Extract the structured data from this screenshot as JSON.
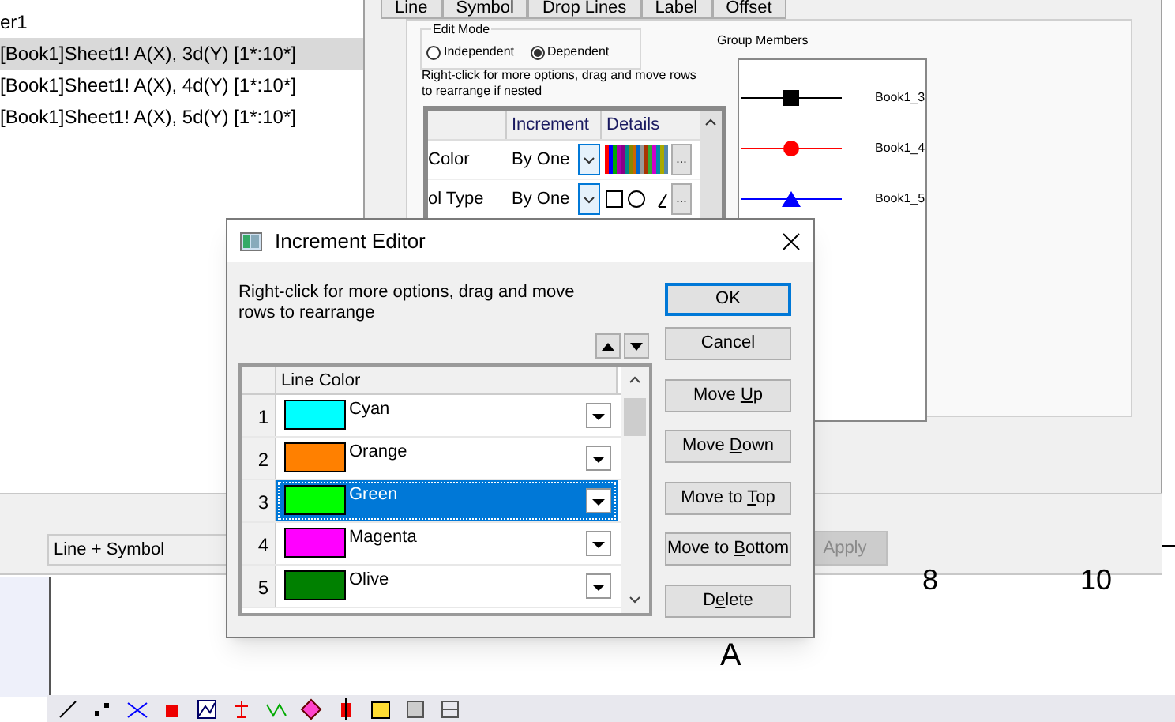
{
  "layer_list": {
    "partial_title": "er1",
    "items": [
      {
        "label": "[Book1]Sheet1! A(X), 3d(Y) [1*:10*]",
        "selected": true
      },
      {
        "label": "[Book1]Sheet1! A(X), 4d(Y) [1*:10*]",
        "selected": false
      },
      {
        "label": "[Book1]Sheet1! A(X), 5d(Y) [1*:10*]",
        "selected": false
      }
    ]
  },
  "plot_details": {
    "tabs": [
      {
        "label": "Line",
        "selected": false
      },
      {
        "label": "Symbol",
        "selected": false
      },
      {
        "label": "Drop Lines",
        "selected": false
      },
      {
        "label": "Label",
        "selected": false
      },
      {
        "label": "Offset",
        "selected": false
      }
    ],
    "edit_mode": {
      "title": "Edit Mode",
      "options": [
        {
          "label": "Independent",
          "selected": false
        },
        {
          "label": "Dependent",
          "selected": true
        }
      ]
    },
    "hint": "Right-click for more options, drag and move rows to  rearrange if nested",
    "table": {
      "columns": [
        "Increment",
        "Details"
      ],
      "rows": [
        {
          "name": "Color",
          "increment": "By One",
          "kind": "colors",
          "more": "..."
        },
        {
          "name": "ol Type",
          "increment": "By One",
          "kind": "symbols",
          "more": "..."
        }
      ]
    },
    "group_members": {
      "title": "Group Members",
      "members": [
        {
          "label": "Book1_3",
          "color": "#000000",
          "kind": "square"
        },
        {
          "label": "Book1_4",
          "color": "#ff0000",
          "kind": "circle"
        },
        {
          "label": "Book1_5",
          "color": "#0000ff",
          "kind": "triangle"
        }
      ]
    },
    "plot_type": "Line + Symbol",
    "apply_button": {
      "label": "Apply",
      "disabled": true
    }
  },
  "graph": {
    "tick_labels": [
      "8",
      "10"
    ],
    "axis_title": "A"
  },
  "increment_editor": {
    "title": "Increment Editor",
    "hint": "Right-click for more options, drag and move rows to  rearrange",
    "column": "Line Color",
    "rows": [
      {
        "index": "1",
        "name": "Cyan",
        "color": "#00ffff",
        "selected": false
      },
      {
        "index": "2",
        "name": "Orange",
        "color": "#ff8000",
        "selected": false
      },
      {
        "index": "3",
        "name": "Green",
        "color": "#00ff00",
        "selected": true
      },
      {
        "index": "4",
        "name": "Magenta",
        "color": "#ff00ff",
        "selected": false
      },
      {
        "index": "5",
        "name": "Olive",
        "color": "#008000",
        "selected": false
      }
    ],
    "buttons": [
      {
        "before": "OK",
        "default": true
      },
      {
        "before": "Cancel",
        "default": false
      },
      {
        "before": "Move ",
        "key": "U",
        "after": "p",
        "default": false
      },
      {
        "before": "Move ",
        "key": "D",
        "after": "own",
        "default": false
      },
      {
        "before": "Move to ",
        "key": "T",
        "after": "op",
        "default": false
      },
      {
        "before": "Move to ",
        "key": "B",
        "after": "ottom",
        "default": false
      },
      {
        "before": "D",
        "key": "e",
        "after": "lete",
        "default": false
      }
    ]
  }
}
